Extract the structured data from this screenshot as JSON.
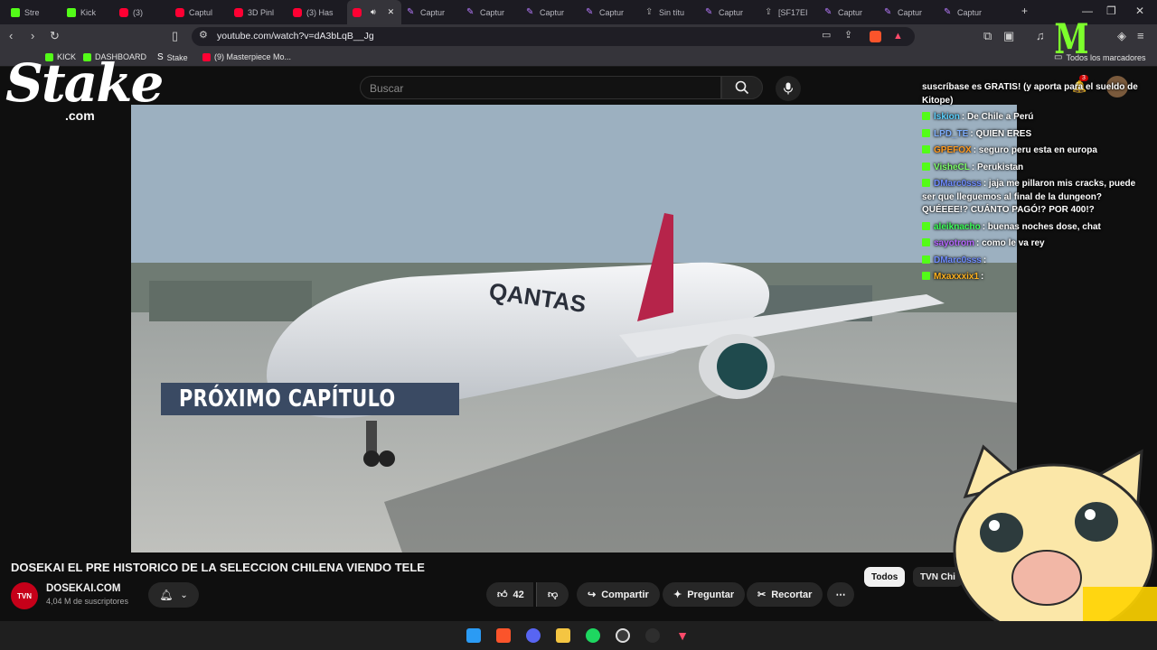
{
  "browser": {
    "tabs": [
      {
        "label": "Stre",
        "icon": "kick"
      },
      {
        "label": "Kick",
        "icon": "kick"
      },
      {
        "label": "(3) ",
        "icon": "youtube"
      },
      {
        "label": "Captul",
        "icon": "youtube"
      },
      {
        "label": "3D Pinl",
        "icon": "youtube"
      },
      {
        "label": "(3) Has",
        "icon": "youtube"
      },
      {
        "label": "",
        "icon": "youtube",
        "active": true
      },
      {
        "label": "Captur",
        "icon": "pen"
      },
      {
        "label": "Captur",
        "icon": "pen"
      },
      {
        "label": "Captur",
        "icon": "pen"
      },
      {
        "label": "Captur",
        "icon": "pen"
      },
      {
        "label": "Sin títu",
        "icon": "upload"
      },
      {
        "label": "Captur",
        "icon": "pen"
      },
      {
        "label": "[SF17EI",
        "icon": "upload"
      },
      {
        "label": "Captur",
        "icon": "pen"
      },
      {
        "label": "Captur",
        "icon": "pen"
      },
      {
        "label": "Captur",
        "icon": "pen"
      }
    ],
    "url": "youtube.com/watch?v=dA3bLqB__Jg",
    "bookmarks": [
      {
        "label": "KICK",
        "icon": "kick"
      },
      {
        "label": "DASHBOARD",
        "icon": "kick"
      },
      {
        "label": "Stake",
        "icon": "stake"
      },
      {
        "label": "(9) Masterpiece Mo...",
        "icon": "youtube"
      }
    ],
    "bookmarks_all": "Todos los marcadores"
  },
  "youtube": {
    "search_placeholder": "Buscar",
    "video_overlay_text": "PRÓXIMO CAPÍTULO",
    "video_title": "DOSEKAI EL PRE HISTORICO DE LA SELECCION CHILENA VIENDO TELE",
    "channel_avatar_text": "TVN",
    "channel_name": "DOSEKAI.COM",
    "subscribers": "4,04 M de suscriptores",
    "likes": "42",
    "share_label": "Compartir",
    "ask_label": "Preguntar",
    "clip_label": "Recortar",
    "chip_all": "Todos",
    "chip_tvn": "TVN Chi"
  },
  "stream_overlay": {
    "logo_text": "Stake",
    "logo_sub": ".com",
    "chat": [
      {
        "user": "",
        "color": "#ffffff",
        "msg": "suscríbase es GRATIS! (y aporta para el sueldo de Kitope)"
      },
      {
        "user": "lskion",
        "color": "#5ad1ff",
        "msg": ": De Chile a Perú"
      },
      {
        "user": "LPD_TE",
        "color": "#7fb0ff",
        "msg": ": QUIEN ERES"
      },
      {
        "user": "GPEFOX",
        "color": "#ff9a1f",
        "msg": ": seguro peru esta en europa"
      },
      {
        "user": "VisheCL",
        "color": "#7dff6a",
        "msg": ": Perukistan"
      },
      {
        "user": "DMarc0sss",
        "color": "#6f8cff",
        "msg": ": jaja me pillaron mis cracks, puede ser que lleguemos al final de la dungeon? QUÉEEE!? CUÁNTO PAGÓ!? POR 400!?"
      },
      {
        "user": "aleiknacho",
        "color": "#3dff5a",
        "msg": ": buenas noches dose, chat"
      },
      {
        "user": "sayotrom",
        "color": "#b565ff",
        "msg": ": como le va rey"
      },
      {
        "user": "DMarc0sss",
        "color": "#6f8cff",
        "msg": ":"
      },
      {
        "user": "Mxaxxxix1",
        "color": "#ffb21f",
        "msg": ":"
      }
    ]
  },
  "colors": {
    "kick_green": "#53fc18",
    "youtube_red": "#ff0033",
    "yt_bg": "#0f0f0f"
  }
}
